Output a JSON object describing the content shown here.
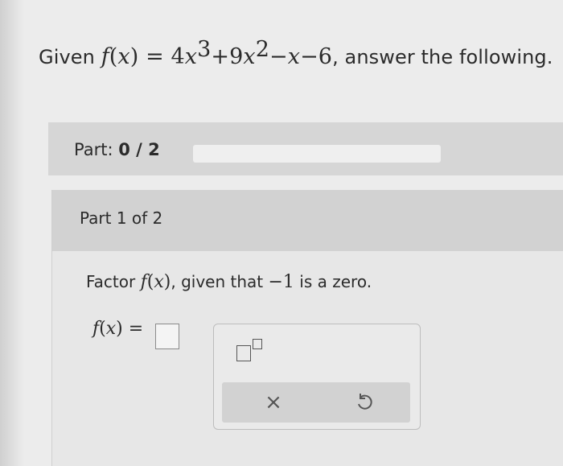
{
  "question": {
    "prefix": "Given",
    "f": "f",
    "open": "(",
    "x": "x",
    "close": ")",
    "equals": " = 4",
    "x1": "x",
    "exp1": "3",
    "plus9": "+9",
    "x2": "x",
    "exp2": "2",
    "minus": "−",
    "x3": "x",
    "minus6": "−6",
    "suffix": ", answer the following."
  },
  "part_bar": {
    "label": "Part:",
    "progress_text": "0 / 2",
    "progress_fraction": 0
  },
  "part": {
    "header": "Part 1 of 2",
    "prompt_prefix": "Factor",
    "prompt_f": "f",
    "prompt_x": "x",
    "prompt_middle": ", given that",
    "prompt_value": "−1",
    "prompt_suffix": "is a zero.",
    "answer_lhs_f": "f",
    "answer_lhs_x": "x",
    "answer_eq": "="
  },
  "keypad": {
    "exponent_icon": "exponent-template-icon",
    "clear_label": "×",
    "undo_icon": "undo-icon"
  },
  "colors": {
    "background": "#ececec",
    "part_bar": "#d6d6d6",
    "card_header": "#d2d2d2"
  }
}
